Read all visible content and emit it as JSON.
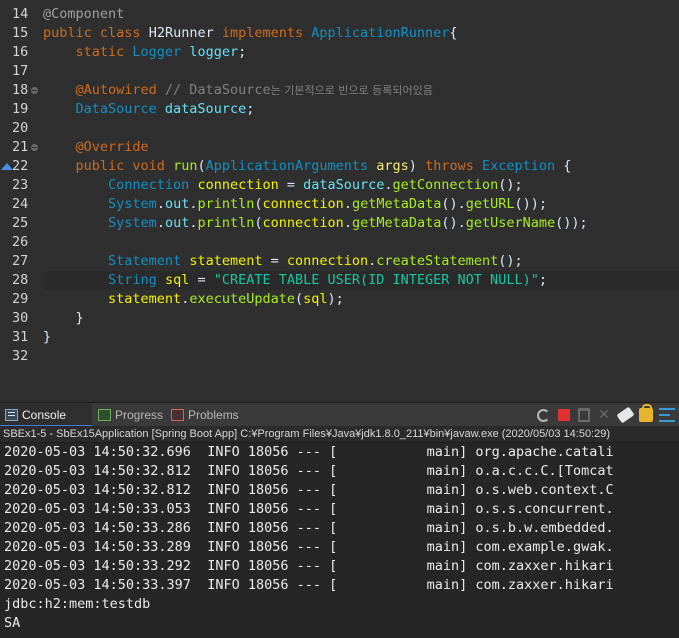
{
  "editor": {
    "gutter": [
      {
        "n": "14",
        "fold": false,
        "marker": false
      },
      {
        "n": "15",
        "fold": false,
        "marker": false
      },
      {
        "n": "16",
        "fold": false,
        "marker": false
      },
      {
        "n": "17",
        "fold": false,
        "marker": false
      },
      {
        "n": "18",
        "fold": true,
        "marker": false
      },
      {
        "n": "19",
        "fold": false,
        "marker": false
      },
      {
        "n": "20",
        "fold": false,
        "marker": false
      },
      {
        "n": "21",
        "fold": true,
        "marker": false
      },
      {
        "n": "22",
        "fold": false,
        "marker": true
      },
      {
        "n": "23",
        "fold": false,
        "marker": false
      },
      {
        "n": "24",
        "fold": false,
        "marker": false
      },
      {
        "n": "25",
        "fold": false,
        "marker": false
      },
      {
        "n": "26",
        "fold": false,
        "marker": false
      },
      {
        "n": "27",
        "fold": false,
        "marker": false
      },
      {
        "n": "28",
        "fold": false,
        "marker": false
      },
      {
        "n": "29",
        "fold": false,
        "marker": false
      },
      {
        "n": "30",
        "fold": false,
        "marker": false
      },
      {
        "n": "31",
        "fold": false,
        "marker": false
      },
      {
        "n": "32",
        "fold": false,
        "marker": false
      }
    ],
    "lines": [
      [
        [
          "ann",
          "@Component"
        ]
      ],
      [
        [
          "kw",
          "public "
        ],
        [
          "kw",
          "class "
        ],
        [
          "plain",
          "H2Runner "
        ],
        [
          "kw",
          "implements "
        ],
        [
          "type",
          "ApplicationRunner"
        ],
        [
          "plain",
          "{"
        ]
      ],
      [
        [
          "plain",
          "    "
        ],
        [
          "kw",
          "static "
        ],
        [
          "type",
          "Logger "
        ],
        [
          "field",
          "logger"
        ],
        [
          "plain",
          ";"
        ]
      ],
      [],
      [
        [
          "plain",
          "    "
        ],
        [
          "annk",
          "@Autowired "
        ],
        [
          "cmt",
          "// DataSource"
        ],
        [
          "cmtk",
          "는 기본적으로 빈으로 등록되어있음"
        ]
      ],
      [
        [
          "plain",
          "    "
        ],
        [
          "type",
          "DataSource "
        ],
        [
          "field",
          "dataSource"
        ],
        [
          "plain",
          ";"
        ]
      ],
      [],
      [
        [
          "plain",
          "    "
        ],
        [
          "annk",
          "@Override"
        ]
      ],
      [
        [
          "plain",
          "    "
        ],
        [
          "kw",
          "public "
        ],
        [
          "kw",
          "void "
        ],
        [
          "m",
          "run"
        ],
        [
          "plain",
          "("
        ],
        [
          "type",
          "ApplicationArguments "
        ],
        [
          "var",
          "args"
        ],
        [
          "plain",
          ") "
        ],
        [
          "kw",
          "throws "
        ],
        [
          "type",
          "Exception "
        ],
        [
          "plain",
          "{"
        ]
      ],
      [
        [
          "plain",
          "        "
        ],
        [
          "type",
          "Connection "
        ],
        [
          "localv",
          "connection"
        ],
        [
          "plain",
          " = "
        ],
        [
          "field",
          "dataSource"
        ],
        [
          "plain",
          "."
        ],
        [
          "m",
          "getConnection"
        ],
        [
          "plain",
          "();"
        ]
      ],
      [
        [
          "plain",
          "        "
        ],
        [
          "type",
          "System"
        ],
        [
          "plain",
          "."
        ],
        [
          "field",
          "out"
        ],
        [
          "plain",
          "."
        ],
        [
          "m",
          "println"
        ],
        [
          "plain",
          "("
        ],
        [
          "localv",
          "connection"
        ],
        [
          "plain",
          "."
        ],
        [
          "m",
          "getMetaData"
        ],
        [
          "plain",
          "()."
        ],
        [
          "m",
          "getURL"
        ],
        [
          "plain",
          "());"
        ]
      ],
      [
        [
          "plain",
          "        "
        ],
        [
          "type",
          "System"
        ],
        [
          "plain",
          "."
        ],
        [
          "field",
          "out"
        ],
        [
          "plain",
          "."
        ],
        [
          "m",
          "println"
        ],
        [
          "plain",
          "("
        ],
        [
          "localv",
          "connection"
        ],
        [
          "plain",
          "."
        ],
        [
          "m",
          "getMetaData"
        ],
        [
          "plain",
          "()."
        ],
        [
          "m",
          "getUserName"
        ],
        [
          "plain",
          "());"
        ]
      ],
      [],
      [
        [
          "plain",
          "        "
        ],
        [
          "type",
          "Statement "
        ],
        [
          "localv",
          "statement"
        ],
        [
          "plain",
          " = "
        ],
        [
          "localv",
          "connection"
        ],
        [
          "plain",
          "."
        ],
        [
          "m",
          "createStatement"
        ],
        [
          "plain",
          "();"
        ]
      ],
      [
        [
          "plain",
          "        "
        ],
        [
          "type",
          "String "
        ],
        [
          "localv",
          "sql"
        ],
        [
          "plain",
          " = "
        ],
        [
          "str",
          "\"CREATE TABLE USER(ID INTEGER NOT NULL)\""
        ],
        [
          "plain",
          ";"
        ]
      ],
      [
        [
          "plain",
          "        "
        ],
        [
          "localv",
          "statement"
        ],
        [
          "plain",
          "."
        ],
        [
          "m",
          "executeUpdate"
        ],
        [
          "plain",
          "("
        ],
        [
          "localv",
          "sql"
        ],
        [
          "plain",
          ");"
        ]
      ],
      [
        [
          "plain",
          "    }"
        ]
      ],
      [
        [
          "plain",
          "}"
        ]
      ],
      []
    ]
  },
  "console": {
    "tabs": [
      {
        "label": "Console",
        "icon": "console-icon",
        "active": true
      },
      {
        "label": "Progress",
        "icon": "progress-icon",
        "active": false
      },
      {
        "label": "Problems",
        "icon": "problems-icon",
        "active": false
      }
    ],
    "title": "SBEx1-5 - SbEx15Application [Spring Boot App] C:¥Program Files¥Java¥jdk1.8.0_211¥bin¥javaw.exe (2020/05/03 14:50:29)",
    "output": [
      "2020-05-03 14:50:32.696  INFO 18056 --- [           main] org.apache.catali",
      "2020-05-03 14:50:32.812  INFO 18056 --- [           main] o.a.c.c.C.[Tomcat",
      "2020-05-03 14:50:32.812  INFO 18056 --- [           main] o.s.web.context.C",
      "2020-05-03 14:50:33.053  INFO 18056 --- [           main] o.s.s.concurrent.",
      "2020-05-03 14:50:33.286  INFO 18056 --- [           main] o.s.b.w.embedded.",
      "2020-05-03 14:50:33.289  INFO 18056 --- [           main] com.example.gwak.",
      "2020-05-03 14:50:33.292  INFO 18056 --- [           main] com.zaxxer.hikari",
      "2020-05-03 14:50:33.397  INFO 18056 --- [           main] com.zaxxer.hikari",
      "jdbc:h2:mem:testdb",
      "SA"
    ]
  }
}
